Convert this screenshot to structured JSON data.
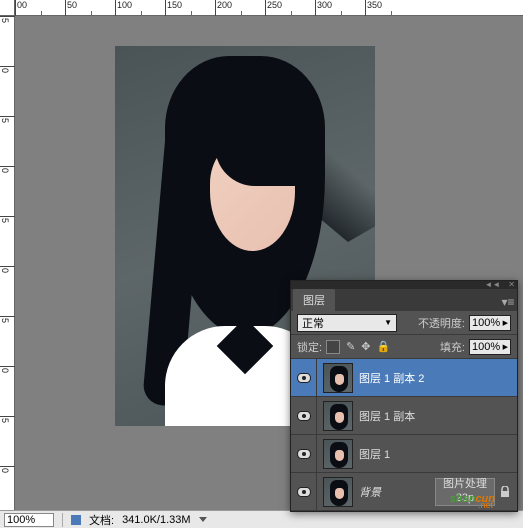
{
  "ruler_h": [
    "00",
    "50",
    "100",
    "150",
    "200",
    "250",
    "300",
    "350"
  ],
  "ruler_v": [
    "5",
    "0",
    "5",
    "0",
    "5",
    "0",
    "5",
    "0",
    "5",
    "0"
  ],
  "status": {
    "zoom": "100%",
    "doc_label": "文档:",
    "doc_value": "341.0K/1.33M"
  },
  "panel": {
    "tab": "图层",
    "blend_mode": "正常",
    "opacity_label": "不透明度:",
    "opacity_value": "100%",
    "lock_label": "锁定:",
    "fill_label": "填充:",
    "fill_value": "100%"
  },
  "layers": [
    {
      "name": "图层 1 副本 2",
      "selected": true
    },
    {
      "name": "图层 1 副本",
      "selected": false
    },
    {
      "name": "图层 1",
      "selected": false
    },
    {
      "name": "背景",
      "selected": false,
      "italic": true,
      "locked": true,
      "tags": [
        "图片处理",
        "23p"
      ]
    }
  ],
  "watermark": {
    "text_g": "shan",
    "text_o": "cun",
    "sub": ".net"
  }
}
